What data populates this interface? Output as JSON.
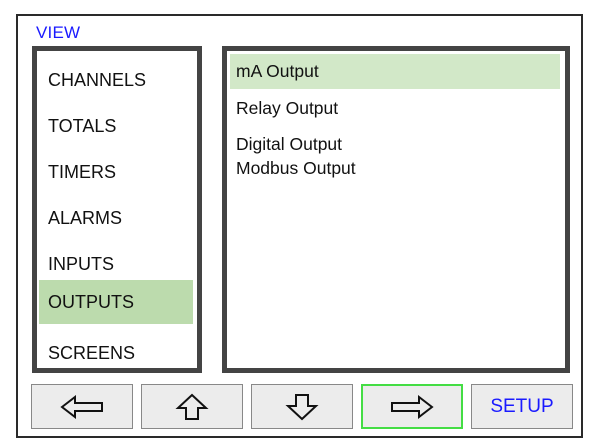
{
  "view": {
    "title": "VIEW"
  },
  "menu": {
    "items": [
      {
        "label": "CHANNELS"
      },
      {
        "label": "TOTALS"
      },
      {
        "label": "TIMERS"
      },
      {
        "label": "ALARMS"
      },
      {
        "label": "INPUTS"
      },
      {
        "label": "OUTPUTS",
        "selected": true
      },
      {
        "label": "SCREENS"
      }
    ]
  },
  "outputs_list": {
    "items": [
      {
        "label": "mA Output",
        "selected": true
      },
      {
        "label": "Relay Output"
      },
      {
        "label": "Digital Output"
      },
      {
        "label": "Modbus Output"
      }
    ]
  },
  "nav": {
    "left_icon": "arrow-left-icon",
    "up_icon": "arrow-up-icon",
    "down_icon": "arrow-down-icon",
    "right_icon": "arrow-right-icon",
    "setup_label": "SETUP"
  },
  "colors": {
    "accent_text": "#1a1aff",
    "menu_selected": "#bcdbad",
    "list_selected": "#d2e8c8",
    "focus_border": "#44dd44"
  }
}
